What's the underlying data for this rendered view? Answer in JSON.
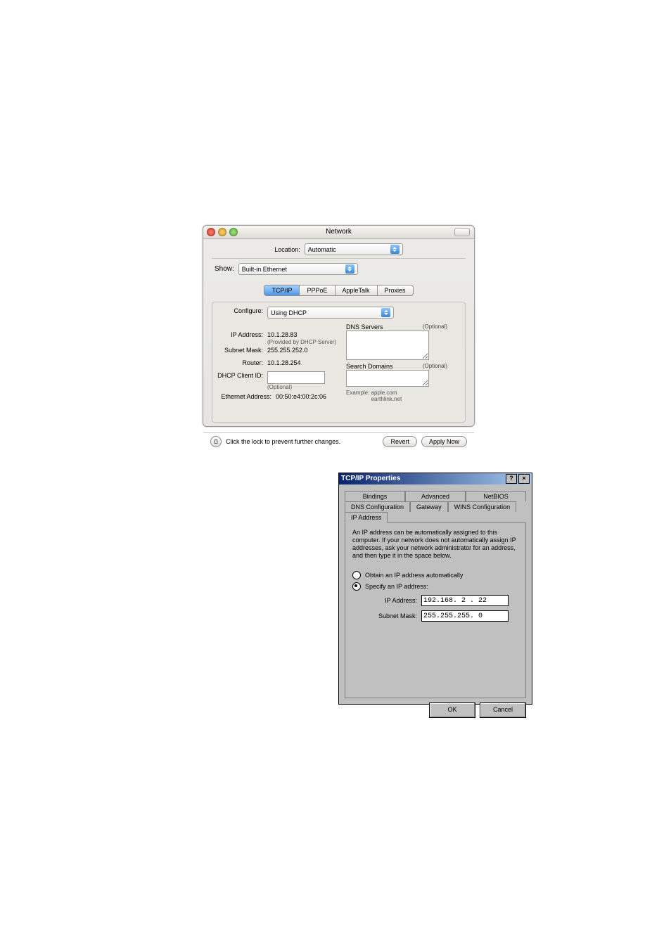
{
  "mac": {
    "title": "Network",
    "location_label": "Location:",
    "location_value": "Automatic",
    "show_label": "Show:",
    "show_value": "Built-in Ethernet",
    "tabs": [
      "TCP/IP",
      "PPPoE",
      "AppleTalk",
      "Proxies"
    ],
    "active_tab": 0,
    "configure_label": "Configure:",
    "configure_value": "Using DHCP",
    "ip_label": "IP Address:",
    "ip_value": "10.1.28.83",
    "ip_note": "(Provided by DHCP Server)",
    "subnet_label": "Subnet Mask:",
    "subnet_value": "255.255.252.0",
    "router_label": "Router:",
    "router_value": "10.1.28.254",
    "dhcp_label": "DHCP Client ID:",
    "dhcp_note": "(Optional)",
    "eth_label": "Ethernet Address:",
    "eth_value": "00:50:e4:00:2c:06",
    "dns_label": "DNS Servers",
    "dns_opt": "(Optional)",
    "sd_label": "Search Domains",
    "sd_opt": "(Optional)",
    "example_label": "Example:",
    "example_value": "apple.com\nearthlink.net",
    "lock_text": "Click the lock to prevent further changes.",
    "revert": "Revert",
    "apply": "Apply Now"
  },
  "win": {
    "title": "TCP/IP Properties",
    "help": "?",
    "close": "×",
    "tabs_row1": [
      "Bindings",
      "Advanced",
      "NetBIOS"
    ],
    "tabs_row2": [
      "DNS Configuration",
      "Gateway",
      "WINS Configuration",
      "IP Address"
    ],
    "active_tab": "IP Address",
    "info": "An IP address can be automatically assigned to this computer. If your network does not automatically assign IP addresses, ask your network administrator for an address, and then type it in the space below.",
    "radio_auto": "Obtain an IP address automatically",
    "radio_manual": "Specify an IP address:",
    "ip_label": "IP Address:",
    "ip_value": "192.168. 2 . 22",
    "mask_label": "Subnet Mask:",
    "mask_value": "255.255.255. 0",
    "ok": "OK",
    "cancel": "Cancel"
  }
}
